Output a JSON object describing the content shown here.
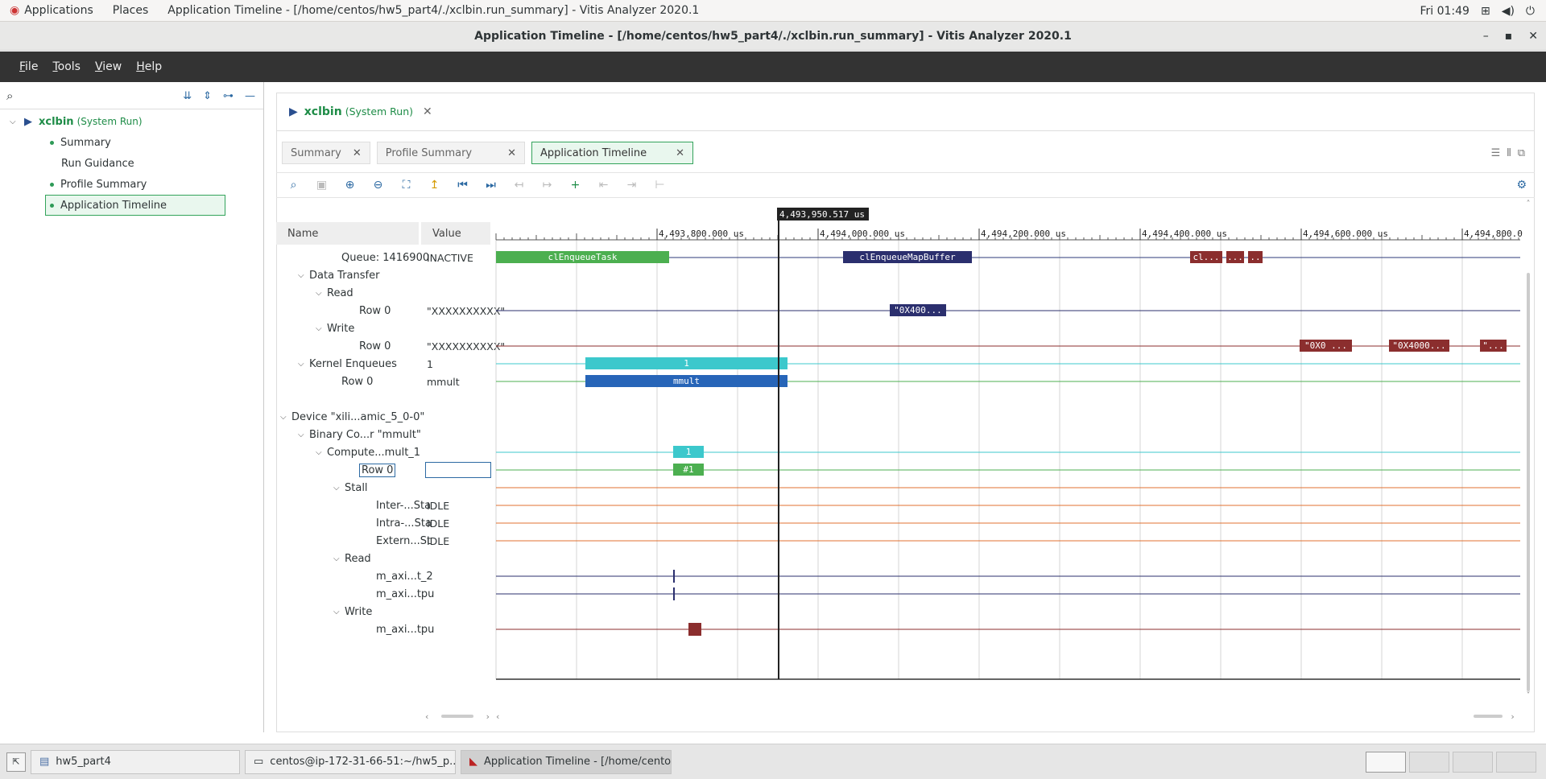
{
  "topbar": {
    "applications": "Applications",
    "places": "Places",
    "window_title": "Application Timeline - [/home/centos/hw5_part4/./xclbin.run_summary] - Vitis Analyzer 2020.1",
    "clock": "Fri 01:49"
  },
  "titlebar": {
    "title": "Application Timeline - [/home/centos/hw5_part4/./xclbin.run_summary] - Vitis Analyzer 2020.1",
    "minimize": "–",
    "maximize": "▪",
    "close": "✕"
  },
  "menu": {
    "file_pre": "",
    "file_u": "F",
    "file_post": "ile",
    "tools_u": "T",
    "tools_post": "ools",
    "view_u": "V",
    "view_post": "iew",
    "help_u": "H",
    "help_post": "elp"
  },
  "tree": {
    "root": "xclbin",
    "root_tag": "(System Run)",
    "items": [
      "Summary",
      "Run Guidance",
      "Profile Summary",
      "Application Timeline"
    ]
  },
  "project_tab": {
    "name": "xclbin",
    "tag": "(System Run)"
  },
  "doc_tabs": [
    "Summary",
    "Profile Summary",
    "Application Timeline"
  ],
  "columns": {
    "name": "Name",
    "value": "Value"
  },
  "cursor_time": "4,493,950.517 us",
  "ticks": [
    "4,493,800.000 us",
    "4,494,000.000 us",
    "4,494,200.000 us",
    "4,494,400.000 us",
    "4,494,600.000 us",
    "4,494,800.0"
  ],
  "rows": [
    {
      "name": "Queue: 1416900",
      "value": "INACTIVE"
    },
    {
      "name": "Data Transfer",
      "value": ""
    },
    {
      "name": "Read",
      "value": ""
    },
    {
      "name": "Row 0",
      "value": "\"XXXXXXXXXX\""
    },
    {
      "name": "Write",
      "value": ""
    },
    {
      "name": "Row 0",
      "value": "\"XXXXXXXXXX\""
    },
    {
      "name": "Kernel Enqueues",
      "value": "1"
    },
    {
      "name": "Row 0",
      "value": "mmult"
    },
    {
      "name": "",
      "value": ""
    },
    {
      "name": "Device \"xili...amic_5_0-0\"",
      "value": ""
    },
    {
      "name": "Binary Co...r \"mmult\"",
      "value": ""
    },
    {
      "name": "Compute...mult_1",
      "value": ""
    },
    {
      "name": "Row 0",
      "value": ""
    },
    {
      "name": "Stall",
      "value": ""
    },
    {
      "name": "Inter-...Sta",
      "value": "IDLE"
    },
    {
      "name": "Intra-...Sta",
      "value": "IDLE"
    },
    {
      "name": "Extern...St",
      "value": "IDLE"
    },
    {
      "name": "Read",
      "value": ""
    },
    {
      "name": "m_axi...t_2",
      "value": ""
    },
    {
      "name": "m_axi...tpu",
      "value": ""
    },
    {
      "name": "Write",
      "value": ""
    },
    {
      "name": "m_axi...tpu",
      "value": ""
    }
  ],
  "bars": {
    "enqueue_task": "clEnqueueTask",
    "map_buffer": "clEnqueueMapBuffer",
    "cl_short": "cl...",
    "dots1": "...",
    "dots2": "..",
    "read_row": "\"0X400...",
    "write1": "\"0X0  ...",
    "write2": "\"0X4000...",
    "write3": "\"...",
    "kernel_count": "1",
    "kernel_name": "mmult",
    "cu_count": "1",
    "cu_run": "#1"
  },
  "colors": {
    "green": "#4caf50",
    "navy": "#2b2f6e",
    "maroon": "#8b2e2e",
    "cyan": "#3cc8cc",
    "blue": "#2765b8",
    "accent": "#33a35b"
  },
  "taskbar": {
    "items": [
      "hw5_part4",
      "centos@ip-172-31-66-51:~/hw5_p...",
      "Application Timeline - [/home/cento..."
    ]
  }
}
